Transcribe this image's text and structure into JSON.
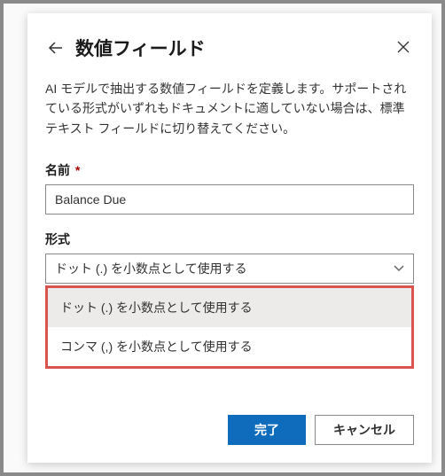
{
  "header": {
    "title": "数値フィールド"
  },
  "description": "AI モデルで抽出する数値フィールドを定義します。サポートされている形式がいずれもドキュメントに適していない場合は、標準テキスト フィールドに切り替えてください。",
  "fields": {
    "name": {
      "label": "名前",
      "required": "*",
      "value": "Balance Due"
    },
    "format": {
      "label": "形式",
      "selected": "ドット (.) を小数点として使用する",
      "options": [
        "ドット (.) を小数点として使用する",
        "コンマ (,) を小数点として使用する"
      ]
    }
  },
  "buttons": {
    "primary": "完了",
    "secondary": "キャンセル"
  }
}
